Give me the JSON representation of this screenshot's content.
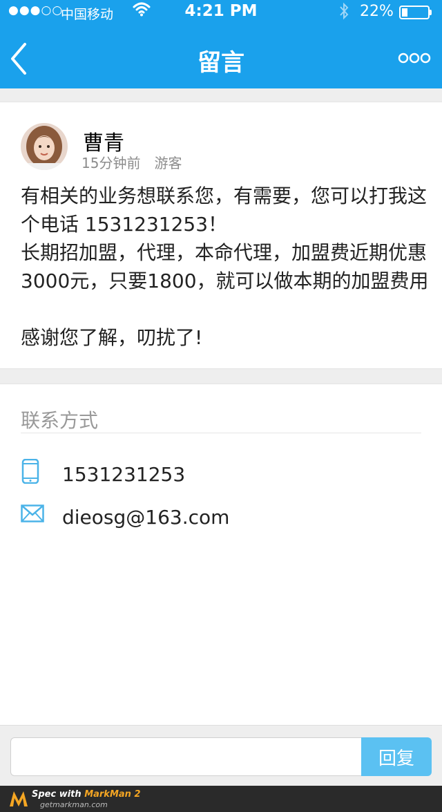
{
  "status_bar": {
    "signal": "●●●○○",
    "carrier": "中国移动",
    "time": "4:21 PM",
    "battery": "22%",
    "battery_level": 0.22
  },
  "nav": {
    "title": "留言",
    "back_icon": "chevron-left-icon",
    "more_icon": "more-dots-icon"
  },
  "message": {
    "author": "曹青",
    "time": "15分钟前",
    "author_type": "游客",
    "lines": [
      "有相关的业务想联系您，有需要，您可以打我这",
      "个电话 1531231253！",
      "长期招加盟，代理，本命代理，加盟费近期优惠",
      "3000元，只要1800，就可以做本期的加盟费用"
    ],
    "closing": "感谢您了解，叨扰了!"
  },
  "contact": {
    "title": "联系方式",
    "phone": "1531231253",
    "email": "dieosg@163.com",
    "phone_icon": "phone-icon",
    "email_icon": "mail-icon"
  },
  "reply": {
    "placeholder": "",
    "button": "回复"
  },
  "footer": {
    "brand_prefix": "Spec with ",
    "brand_name": "MarkMan 2",
    "site": "getmarkman.com"
  },
  "colors": {
    "nav_bg": "#1aa1ec",
    "name_text": "#000000",
    "meta_text": "#8c8c8c",
    "body_text": "#222222",
    "contact_title": "#999999",
    "divider": "#e5e5e5",
    "card_border": "#e4e4e4",
    "page_bg": "#eeeeee",
    "reply_button": "#5bc1f2"
  }
}
